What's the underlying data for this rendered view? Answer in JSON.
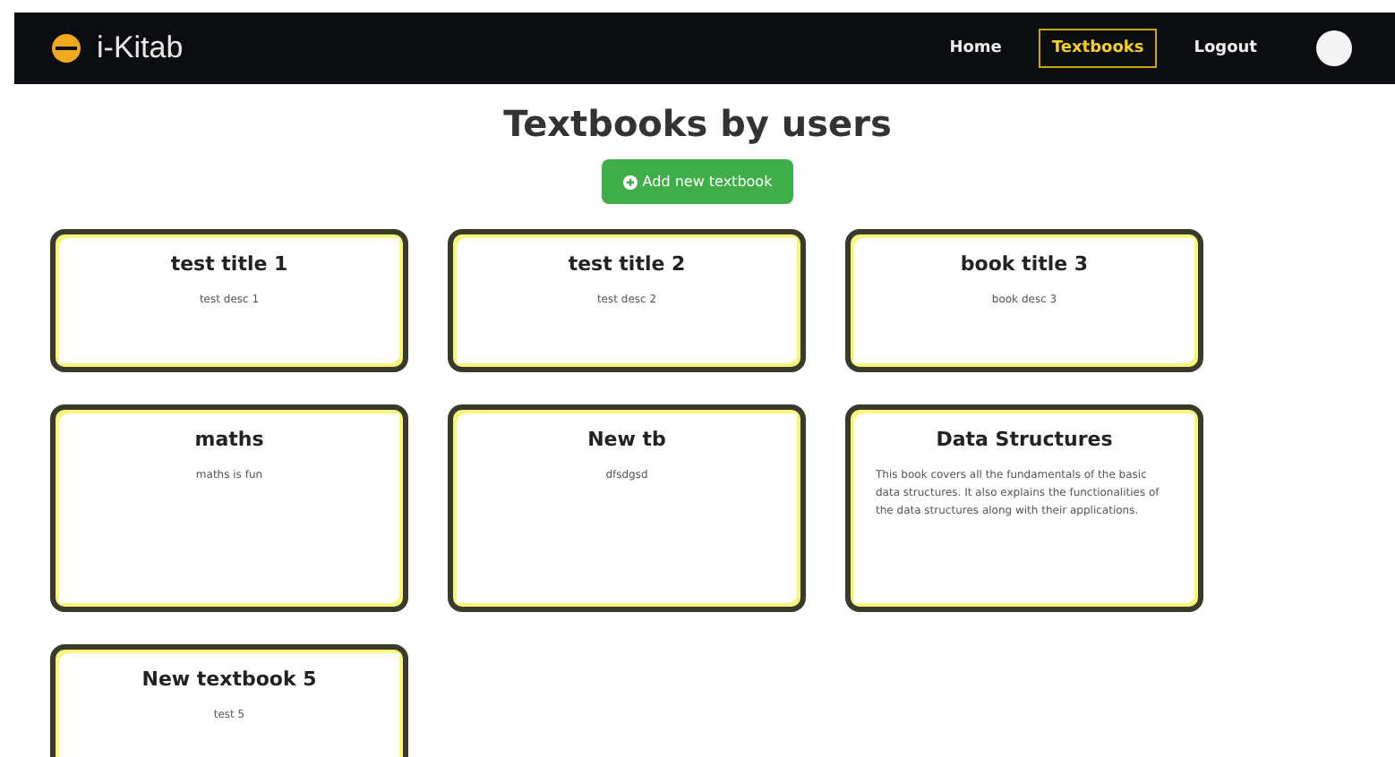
{
  "navbar": {
    "brand": "i-Kitab",
    "links": [
      {
        "label": "Home",
        "selected": false
      },
      {
        "label": "Textbooks",
        "selected": true
      },
      {
        "label": "Logout",
        "selected": false
      }
    ]
  },
  "heading": "Textbooks by users",
  "add_button": "Add new textbook",
  "textbooks": [
    {
      "title": "test title 1",
      "description": "test desc 1"
    },
    {
      "title": "test title 2",
      "description": "test desc 2"
    },
    {
      "title": "book title 3",
      "description": "book desc 3"
    },
    {
      "title": "maths",
      "description": "maths is fun"
    },
    {
      "title": "New tb",
      "description": "dfsdgsd"
    },
    {
      "title": "Data Structures",
      "description": "This book covers all the fundamentals of the basic data structures. It also explains the functionalities of the data structures along with their applications."
    },
    {
      "title": "New textbook 5",
      "description": "test 5"
    }
  ]
}
